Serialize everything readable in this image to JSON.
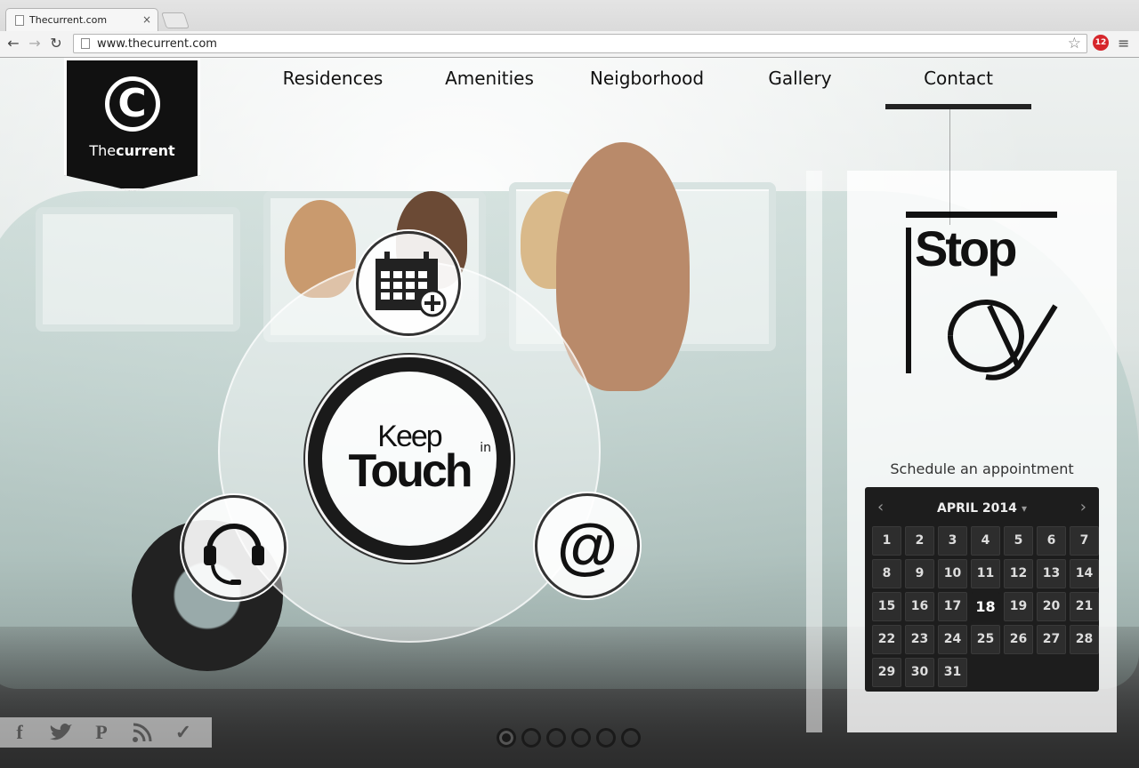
{
  "browser": {
    "tab_title": "Thecurrent.com",
    "tab_close": "×",
    "url": "www.thecurrent.com",
    "back": "←",
    "forward": "→",
    "reload": "↻",
    "star": "☆",
    "ext_badge": "12",
    "menu": "≡"
  },
  "logo": {
    "letter": "C",
    "text_light": "The",
    "text_bold": "current"
  },
  "nav": {
    "items": [
      "Residences",
      "Amenities",
      "Neigborhood",
      "Gallery",
      "Contact"
    ],
    "active": "Contact"
  },
  "contact": {
    "keep": "Keep",
    "in": "in",
    "touch": "Touch",
    "email_symbol": "@"
  },
  "panel": {
    "stop": "Stop",
    "by": "by",
    "schedule_label": "Schedule an appointment",
    "calendar": {
      "month_label": "APRIL 2014",
      "dropdown": "▾",
      "prev": "‹",
      "next": "›",
      "today": "18",
      "days": [
        "1",
        "2",
        "3",
        "4",
        "5",
        "6",
        "7",
        "8",
        "9",
        "10",
        "11",
        "12",
        "13",
        "14",
        "15",
        "16",
        "17",
        "18",
        "19",
        "20",
        "21",
        "22",
        "23",
        "24",
        "25",
        "26",
        "27",
        "28",
        "29",
        "30",
        "31"
      ]
    }
  },
  "social": {
    "icons": [
      "facebook-icon",
      "twitter-icon",
      "pinterest-icon",
      "rss-icon",
      "check-icon"
    ],
    "glyphs": [
      "f",
      "🐦",
      "P",
      "◢",
      "✓"
    ]
  },
  "slider": {
    "count": 6,
    "active_index": 0
  },
  "colors": {
    "dark": "#111111",
    "calendar_bg": "#1d1d1d",
    "panel_bg": "#ffffff"
  }
}
